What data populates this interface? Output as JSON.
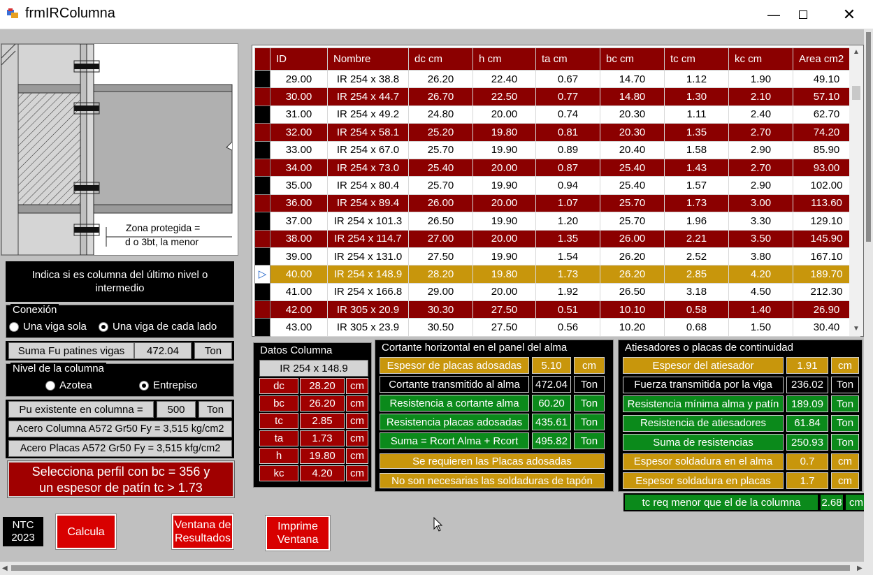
{
  "window": {
    "title": "frmIRColumna"
  },
  "drawing": {
    "note_line1": "Zona protegida =",
    "note_line2": "d o 3bt, la menor"
  },
  "left": {
    "indica": "Indica si es columna del último nivel o intermedio",
    "conexion": {
      "title": "Conexión",
      "opt1": "Una viga sola",
      "opt2": "Una viga de cada lado"
    },
    "suma_fu": {
      "label": "Suma Fu patines vigas",
      "value": "472.04",
      "unit": "Ton"
    },
    "nivel": {
      "title": "Nivel de la columna",
      "opt1": "Azotea",
      "opt2": "Entrepiso"
    },
    "pu": {
      "label": "Pu existente en columna  =",
      "value": "500",
      "unit": "Ton"
    },
    "acero_columna": "Acero Columna A572 Gr50 Fy = 3,515 kg/cm2",
    "acero_placas": "Acero Placas A572 Gr50    Fy = 3,515 kfg/cm2",
    "msg_line1": "Selecciona perfil con      bc = 356  y",
    "msg_line2": "un espesor de patín tc > 1.73"
  },
  "buttons": {
    "ntc_line1": "NTC",
    "ntc_line2": "2023",
    "calcula": "Calcula",
    "resultados_line1": "Ventana de",
    "resultados_line2": "Resultados",
    "imprime_line1": "Imprime",
    "imprime_line2": "Ventana"
  },
  "grid": {
    "headers": [
      "ID",
      "Nombre",
      "dc cm",
      "h cm",
      "ta cm",
      "bc cm",
      "tc cm",
      "kc cm",
      "Area cm2"
    ],
    "rows": [
      [
        "29.00",
        "IR 254 x 38.8",
        "26.20",
        "22.40",
        "0.67",
        "14.70",
        "1.12",
        "1.90",
        "49.10"
      ],
      [
        "30.00",
        "IR 254 x 44.7",
        "26.70",
        "22.50",
        "0.77",
        "14.80",
        "1.30",
        "2.10",
        "57.10"
      ],
      [
        "31.00",
        "IR 254 x 49.2",
        "24.80",
        "20.00",
        "0.74",
        "20.30",
        "1.11",
        "2.40",
        "62.70"
      ],
      [
        "32.00",
        "IR 254 x 58.1",
        "25.20",
        "19.80",
        "0.81",
        "20.30",
        "1.35",
        "2.70",
        "74.20"
      ],
      [
        "33.00",
        "IR 254 x 67.0",
        "25.70",
        "19.90",
        "0.89",
        "20.40",
        "1.58",
        "2.90",
        "85.90"
      ],
      [
        "34.00",
        "IR 254 x 73.0",
        "25.40",
        "20.00",
        "0.87",
        "25.40",
        "1.43",
        "2.70",
        "93.00"
      ],
      [
        "35.00",
        "IR 254 x 80.4",
        "25.70",
        "19.90",
        "0.94",
        "25.40",
        "1.57",
        "2.90",
        "102.00"
      ],
      [
        "36.00",
        "IR 254 x 89.4",
        "26.00",
        "20.00",
        "1.07",
        "25.70",
        "1.73",
        "3.00",
        "113.60"
      ],
      [
        "37.00",
        "IR 254 x 101.3",
        "26.50",
        "19.90",
        "1.20",
        "25.70",
        "1.96",
        "3.30",
        "129.10"
      ],
      [
        "38.00",
        "IR 254 x 114.7",
        "27.00",
        "20.00",
        "1.35",
        "26.00",
        "2.21",
        "3.50",
        "145.90"
      ],
      [
        "39.00",
        "IR 254 x 131.0",
        "27.50",
        "19.90",
        "1.54",
        "26.20",
        "2.52",
        "3.80",
        "167.10"
      ],
      [
        "40.00",
        "IR 254 x 148.9",
        "28.20",
        "19.80",
        "1.73",
        "26.20",
        "2.85",
        "4.20",
        "189.70"
      ],
      [
        "41.00",
        "IR 254 x 166.8",
        "29.00",
        "20.00",
        "1.92",
        "26.50",
        "3.18",
        "4.50",
        "212.30"
      ],
      [
        "42.00",
        "IR 305 x 20.9",
        "30.30",
        "27.50",
        "0.51",
        "10.10",
        "0.58",
        "1.40",
        "26.90"
      ],
      [
        "43.00",
        "IR 305 x 23.9",
        "30.50",
        "27.50",
        "0.56",
        "10.20",
        "0.68",
        "1.50",
        "30.40"
      ]
    ],
    "selected_marker": "▷"
  },
  "datos": {
    "title": "Datos Columna",
    "perfil": "IR 254 x 148.9",
    "rows": [
      {
        "label": "dc",
        "value": "28.20",
        "unit": "cm"
      },
      {
        "label": "bc",
        "value": "26.20",
        "unit": "cm"
      },
      {
        "label": "tc",
        "value": "2.85",
        "unit": "cm"
      },
      {
        "label": "ta",
        "value": "1.73",
        "unit": "cm"
      },
      {
        "label": "h",
        "value": "19.80",
        "unit": "cm"
      },
      {
        "label": "kc",
        "value": "4.20",
        "unit": "cm"
      }
    ]
  },
  "cortante": {
    "title": "Cortante horizontal en el panel del alma",
    "rows": [
      {
        "label": "Espesor de placas adosadas",
        "value": "5.10",
        "unit": "cm"
      },
      {
        "label": "Cortante transmitido al alma",
        "value": "472.04",
        "unit": "Ton"
      },
      {
        "label": "Resistencia a cortante alma",
        "value": "60.20",
        "unit": "Ton"
      },
      {
        "label": "Resistencia placas adosadas",
        "value": "435.61",
        "unit": "Ton"
      },
      {
        "label": "Suma = Rcort Alma + Rcort",
        "value": "495.82",
        "unit": "Ton"
      }
    ],
    "msg1": "Se requieren las Placas adosadas",
    "msg2": "No son necesarias las  soldaduras de tapón"
  },
  "atiesadores": {
    "title": "Atiesadores o placas de continuidad",
    "rows": [
      {
        "label": "Espesor del atiesador",
        "value": "1.91",
        "unit": "cm"
      },
      {
        "label": "Fuerza transmitida por la viga",
        "value": "236.02",
        "unit": "Ton"
      },
      {
        "label": "Resistencia mínima alma y patín",
        "value": "189.09",
        "unit": "Ton"
      },
      {
        "label": "Resistencia de atiesadores",
        "value": "61.84",
        "unit": "Ton"
      },
      {
        "label": "Suma de resistencias",
        "value": "250.93",
        "unit": "Ton"
      },
      {
        "label": "Espesor soldadura en el alma",
        "value": "0.7",
        "unit": "cm"
      },
      {
        "label": "Espesor soldadura en placas",
        "value": "1.7",
        "unit": "cm"
      }
    ],
    "tcreq": {
      "label": "tc req menor que el de la columna",
      "value": "2.68",
      "unit": "cm"
    }
  },
  "colors": {
    "dark_red": "#8b0000",
    "green": "#0b8a1b",
    "gold": "#c8960c",
    "button_red": "#d80000"
  }
}
